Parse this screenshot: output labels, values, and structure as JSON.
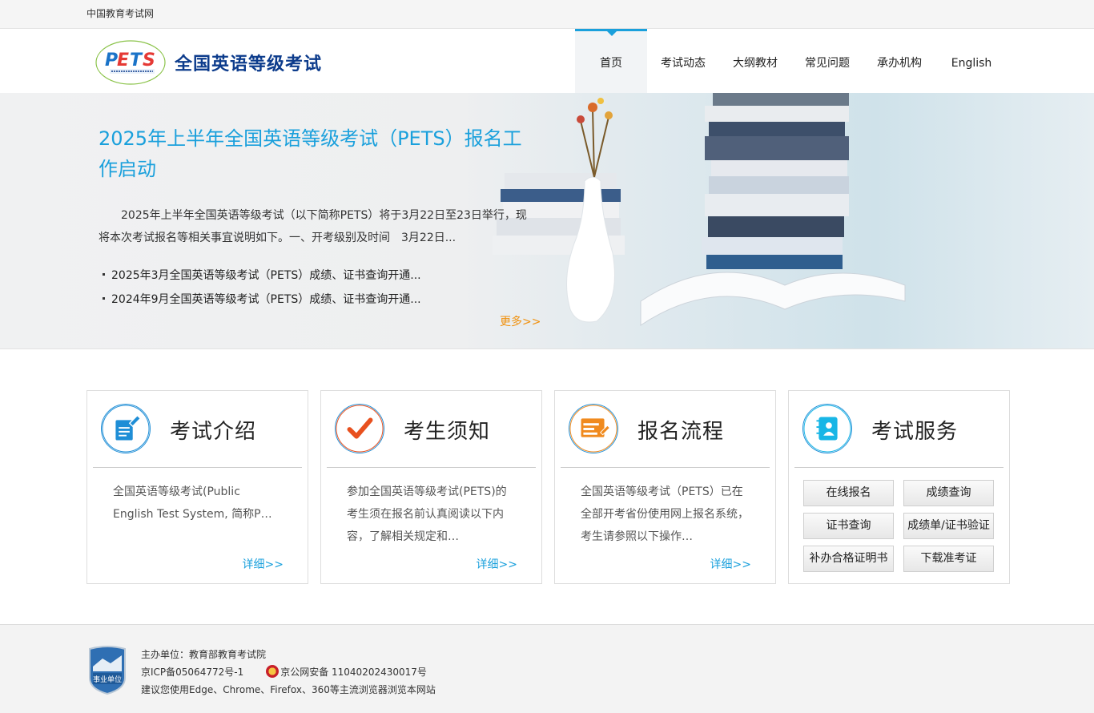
{
  "topbar": {
    "site_link": "中国教育考试网"
  },
  "header": {
    "logo_text": "PETS",
    "logo_subtext": "全国英语等级考试",
    "title": "全国英语等级考试"
  },
  "nav": {
    "items": [
      {
        "label": "首页",
        "active": true
      },
      {
        "label": "考试动态"
      },
      {
        "label": "大纲教材"
      },
      {
        "label": "常见问题"
      },
      {
        "label": "承办机构"
      },
      {
        "label": "English"
      }
    ]
  },
  "banner": {
    "headline": "2025年上半年全国英语等级考试（PETS）报名工作启动",
    "summary": "2025年上半年全国英语等级考试（以下简称PETS）将于3月22日至23日举行，现将本次考试报名等相关事宜说明如下。一、开考级别及时间　3月22日...",
    "news": [
      "2025年3月全国英语等级考试（PETS）成绩、证书查询开通...",
      "2024年9月全国英语等级考试（PETS）成绩、证书查询开通..."
    ],
    "more": "更多>>"
  },
  "cards": [
    {
      "icon": "document-edit-icon",
      "title": "考试介绍",
      "text": "全国英语等级考试(Public English Test System, 简称P…",
      "more": "详细>>"
    },
    {
      "icon": "checkmark-icon",
      "title": "考生须知",
      "text": "参加全国英语等级考试(PETS)的考生须在报名前认真阅读以下内容，了解相关规定和…",
      "more": "详细>>"
    },
    {
      "icon": "web-form-icon",
      "title": "报名流程",
      "text": "全国英语等级考试（PETS）已在全部开考省份使用网上报名系统，考生请参照以下操作…",
      "more": "详细>>"
    },
    {
      "icon": "address-book-icon",
      "title": "考试服务"
    }
  ],
  "services": [
    "在线报名",
    "成绩查询",
    "证书查询",
    "成绩单/证书验证",
    "补办合格证明书",
    "下载准考证"
  ],
  "footer": {
    "badge_text": "事业单位",
    "host": "主办单位：教育部教育考试院",
    "icp": "京ICP备05064772号-1",
    "police": "京公网安备 11040202430017号",
    "browser_note": "建议您使用Edge、Chrome、Firefox、360等主流浏览器浏览本网站"
  },
  "colors": {
    "accent": "#1aa0dc",
    "title_blue": "#0d3c8c",
    "more_orange": "#f0900c",
    "check_orange": "#e8501e"
  }
}
